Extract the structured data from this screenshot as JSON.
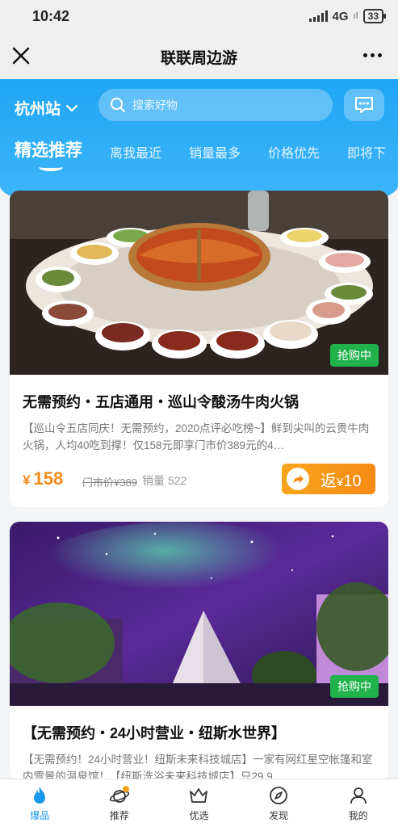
{
  "status": {
    "time": "10:42",
    "network": "4G",
    "battery": "33"
  },
  "header": {
    "title": "联联周边游"
  },
  "location": {
    "city": "杭州站"
  },
  "search": {
    "placeholder": "搜索好物"
  },
  "tabs": [
    {
      "label": "精选推荐",
      "active": true
    },
    {
      "label": "离我最近"
    },
    {
      "label": "销量最多"
    },
    {
      "label": "价格优先"
    },
    {
      "label": "即将下"
    }
  ],
  "products": [
    {
      "badge": "抢购中",
      "title": "无需预约・五店通用・巡山令酸汤牛肉火锅",
      "description": "【巡山令五店同庆！无需预约，2020点评必吃榜~】鲜到尖叫的云贵牛肉火锅，人均40吃到撑！仅158元即享门市价389元的4…",
      "currency": "¥",
      "price": "158",
      "original_price": "门市价¥389",
      "sales": "销量 522",
      "rebate_prefix": "返",
      "rebate_currency": "¥",
      "rebate_amount": "10"
    },
    {
      "badge": "抢购中",
      "title": "【无需预约・24小时营业・纽斯水世界】",
      "description": "【无需预约！24小时营业！纽斯未来科技城店】一家有网红星空帐篷和室内雪景的温泉馆！【纽斯洗浴未来科技城店】只29.9…"
    }
  ],
  "bottom_nav": [
    {
      "label": "爆品",
      "icon": "flame-icon",
      "active": true
    },
    {
      "label": "推荐",
      "icon": "planet-icon"
    },
    {
      "label": "优选",
      "icon": "crown-icon"
    },
    {
      "label": "发现",
      "icon": "compass-icon"
    },
    {
      "label": "我的",
      "icon": "user-icon"
    }
  ],
  "colors": {
    "brand_blue": "#1fa6f5",
    "price_orange": "#f38a17",
    "badge_green": "#21b24b",
    "nav_active": "#1a98f0"
  }
}
